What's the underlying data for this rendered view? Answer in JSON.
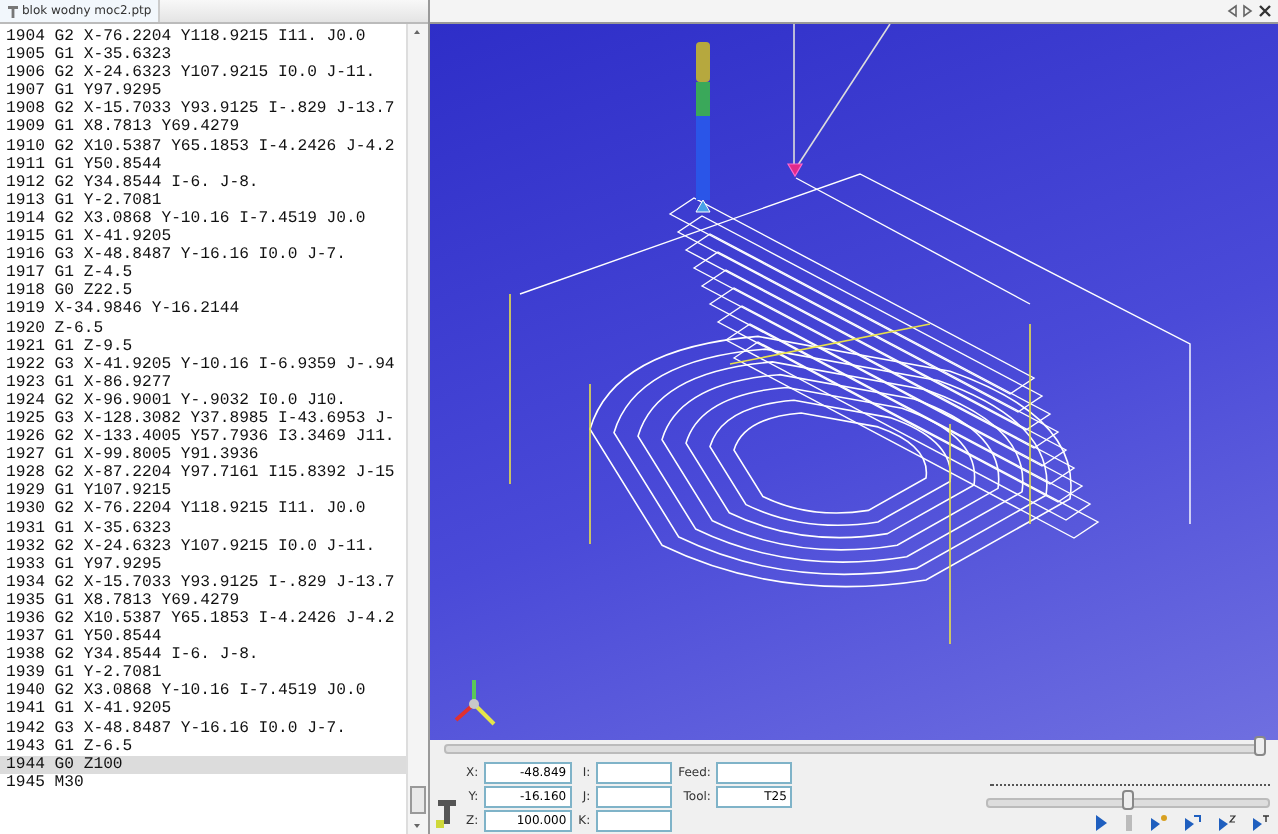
{
  "tab": {
    "title": "blok wodny moc2.ptp"
  },
  "code_lines": [
    {
      "text": "1904 G2 X-76.2204 Y118.9215 I11. J0.0",
      "selected": false
    },
    {
      "text": "1905 G1 X-35.6323",
      "selected": false
    },
    {
      "text": "1906 G2 X-24.6323 Y107.9215 I0.0 J-11.",
      "selected": false
    },
    {
      "text": "1907 G1 Y97.9295",
      "selected": false
    },
    {
      "text": "1908 G2 X-15.7033 Y93.9125 I-.829 J-13.7",
      "selected": false
    },
    {
      "text": "1909 G1 X8.7813 Y69.4279",
      "selected": false
    },
    {
      "text": "1910 G2 X10.5387 Y65.1853 I-4.2426 J-4.2",
      "selected": false
    },
    {
      "text": "1911 G1 Y50.8544",
      "selected": false
    },
    {
      "text": "1912 G2 Y34.8544 I-6. J-8.",
      "selected": false
    },
    {
      "text": "1913 G1 Y-2.7081",
      "selected": false
    },
    {
      "text": "1914 G2 X3.0868 Y-10.16 I-7.4519 J0.0",
      "selected": false
    },
    {
      "text": "1915 G1 X-41.9205",
      "selected": false
    },
    {
      "text": "1916 G3 X-48.8487 Y-16.16 I0.0 J-7.",
      "selected": false
    },
    {
      "text": "1917 G1 Z-4.5",
      "selected": false
    },
    {
      "text": "1918 G0 Z22.5",
      "selected": false
    },
    {
      "text": "1919 X-34.9846 Y-16.2144",
      "selected": false
    },
    {
      "text": "1920 Z-6.5",
      "selected": false
    },
    {
      "text": "1921 G1 Z-9.5",
      "selected": false
    },
    {
      "text": "1922 G3 X-41.9205 Y-10.16 I-6.9359 J-.94",
      "selected": false
    },
    {
      "text": "1923 G1 X-86.9277",
      "selected": false
    },
    {
      "text": "1924 G2 X-96.9001 Y-.9032 I0.0 J10.",
      "selected": false
    },
    {
      "text": "1925 G3 X-128.3082 Y37.8985 I-43.6953 J-",
      "selected": false
    },
    {
      "text": "1926 G2 X-133.4005 Y57.7936 I3.3469 J11.",
      "selected": false
    },
    {
      "text": "1927 G1 X-99.8005 Y91.3936",
      "selected": false
    },
    {
      "text": "1928 G2 X-87.2204 Y97.7161 I15.8392 J-15",
      "selected": false
    },
    {
      "text": "1929 G1 Y107.9215",
      "selected": false
    },
    {
      "text": "1930 G2 X-76.2204 Y118.9215 I11. J0.0",
      "selected": false
    },
    {
      "text": "1931 G1 X-35.6323",
      "selected": false
    },
    {
      "text": "1932 G2 X-24.6323 Y107.9215 I0.0 J-11.",
      "selected": false
    },
    {
      "text": "1933 G1 Y97.9295",
      "selected": false
    },
    {
      "text": "1934 G2 X-15.7033 Y93.9125 I-.829 J-13.7",
      "selected": false
    },
    {
      "text": "1935 G1 X8.7813 Y69.4279",
      "selected": false
    },
    {
      "text": "1936 G2 X10.5387 Y65.1853 I-4.2426 J-4.2",
      "selected": false
    },
    {
      "text": "1937 G1 Y50.8544",
      "selected": false
    },
    {
      "text": "1938 G2 Y34.8544 I-6. J-8.",
      "selected": false
    },
    {
      "text": "1939 G1 Y-2.7081",
      "selected": false
    },
    {
      "text": "1940 G2 X3.0868 Y-10.16 I-7.4519 J0.0",
      "selected": false
    },
    {
      "text": "1941 G1 X-41.9205",
      "selected": false
    },
    {
      "text": "1942 G3 X-48.8487 Y-16.16 I0.0 J-7.",
      "selected": false
    },
    {
      "text": "1943 G1 Z-6.5",
      "selected": false
    },
    {
      "text": "1944 G0 Z100",
      "selected": true
    },
    {
      "text": "1945 M30",
      "selected": false
    }
  ],
  "progress_slider": {
    "level": 1.0
  },
  "speed_slider": {
    "level": 0.5
  },
  "fields": [
    {
      "label": "X:",
      "value": "-48.849"
    },
    {
      "label": "I:"
    },
    {
      "label": "Feed:"
    },
    {
      "label": "Y:",
      "value": "-16.160"
    },
    {
      "label": "J:"
    },
    {
      "label": "Tool:",
      "value": "T25"
    },
    {
      "label": "Z:",
      "value": "100.000"
    },
    {
      "label": "K:"
    }
  ]
}
